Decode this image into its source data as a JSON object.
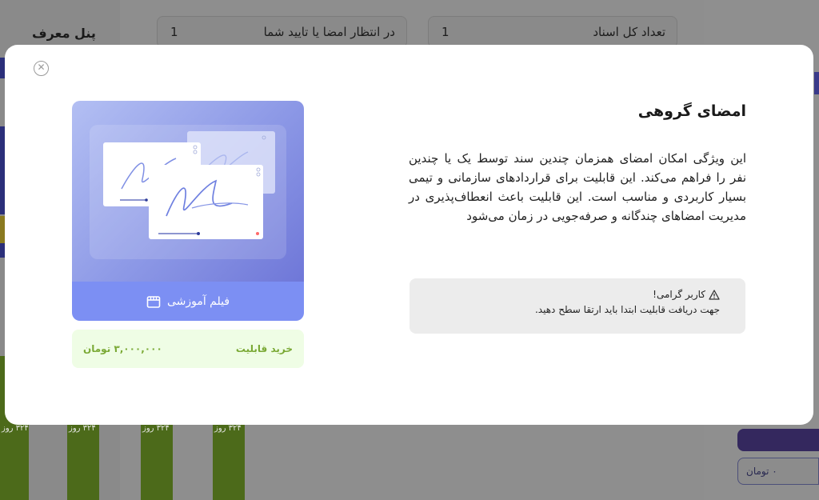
{
  "background": {
    "panel_title": "پنل معرف",
    "stats": [
      {
        "label": "تعداد کل اسناد",
        "value": "1"
      },
      {
        "label": "در انتظار امضا یا تایید شما",
        "value": "1"
      }
    ],
    "bar_label": "۳۲۴ روز",
    "price_input": "۰ تومان"
  },
  "modal": {
    "close_icon": "close-icon",
    "title": "امضای گروهی",
    "description": "این ویژگی امکان امضای همزمان چندین سند توسط یک یا چندین نفر را فراهم می‌کند. این قابلیت برای قراردادهای سازمانی و تیمی بسیار کاربردی و مناسب است. این قابلیت باعث انعطاف‌پذیری در مدیریت امضاهای چندگانه و صرفه‌جویی در زمان می‌شود",
    "notice": {
      "icon": "warning-icon",
      "heading": "کاربر گرامی!",
      "text": "جهت دریافت قابلیت ابتدا باید ارتقا سطح دهید."
    },
    "media": {
      "video_label": "فیلم آموزشی",
      "video_icon": "film-icon"
    },
    "purchase": {
      "buy_label": "خرید قابلیت",
      "price": "۳,۰۰۰,۰۰۰ تومان"
    }
  },
  "colors": {
    "accent": "#7c8ff3",
    "price_green": "#7aa935",
    "price_bg": "#effde5"
  }
}
